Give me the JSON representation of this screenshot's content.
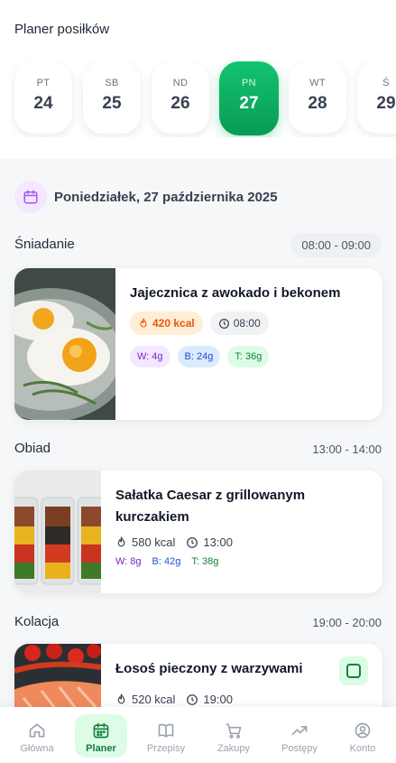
{
  "header": {
    "title": "Planer posiłków"
  },
  "days": [
    {
      "name": "PT",
      "num": "24"
    },
    {
      "name": "SB",
      "num": "25"
    },
    {
      "name": "ND",
      "num": "26"
    },
    {
      "name": "PN",
      "num": "27",
      "active": true
    },
    {
      "name": "WT",
      "num": "28"
    },
    {
      "name": "Ś",
      "num": "29"
    }
  ],
  "selected_date": "Poniedziałek, 27 października 2025",
  "meals": [
    {
      "type": "Śniadanie",
      "time_range": "08:00 - 09:00",
      "name": "Jajecznica z awokado i bekonem",
      "kcal": "420 kcal",
      "time": "08:00",
      "w": "W: 4g",
      "b": "B: 24g",
      "t": "T: 36g"
    },
    {
      "type": "Obiad",
      "time_range": "13:00 - 14:00",
      "name": "Sałatka Caesar z grillowanym kurczakiem",
      "kcal": "580 kcal",
      "time": "13:00",
      "w": "W: 8g",
      "b": "B: 42g",
      "t": "T: 38g"
    },
    {
      "type": "Kolacja",
      "time_range": "19:00 - 20:00",
      "name": "Łosoś pieczony z warzywami",
      "kcal": "520 kcal",
      "time": "19:00"
    }
  ],
  "nav": [
    {
      "label": "Główna",
      "icon": "home-icon"
    },
    {
      "label": "Planer",
      "icon": "calendar-icon",
      "active": true
    },
    {
      "label": "Przepisy",
      "icon": "book-icon"
    },
    {
      "label": "Zakupy",
      "icon": "cart-icon"
    },
    {
      "label": "Postępy",
      "icon": "trend-icon"
    },
    {
      "label": "Konto",
      "icon": "user-icon"
    }
  ],
  "colors": {
    "accent": "#0fa960",
    "kcal": "#ea580c",
    "carbs": "#7e22ce",
    "protein": "#1d4ed8",
    "fat": "#15803d"
  }
}
